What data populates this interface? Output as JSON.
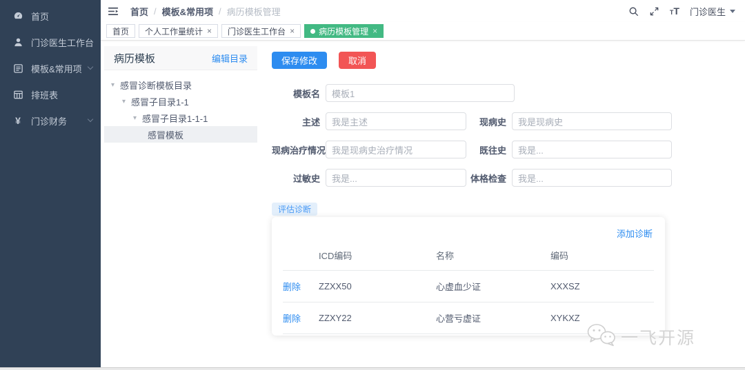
{
  "colors": {
    "sidebar_bg": "#304156",
    "primary_blue": "#2d8cf0",
    "danger_red": "#f25555",
    "tab_green": "#42b983",
    "text_dark": "#515a6e"
  },
  "icons": {
    "close": "×",
    "tree_caret": "▾",
    "yuan": "¥",
    "font_size_small": "T",
    "font_size_large": "T"
  },
  "sidebar": {
    "items": [
      {
        "label": "首页",
        "icon": "dashboard-icon",
        "has_arrow": false
      },
      {
        "label": "门诊医生工作台",
        "icon": "user-icon",
        "has_arrow": false
      },
      {
        "label": "模板&常用项",
        "icon": "template-list-icon",
        "has_arrow": true
      },
      {
        "label": "排班表",
        "icon": "schedule-table-icon",
        "has_arrow": false
      },
      {
        "label": "门诊财务",
        "icon": "yuan-icon",
        "has_arrow": true
      }
    ]
  },
  "header": {
    "breadcrumb": [
      "首页",
      "模板&常用项",
      "病历模板管理"
    ],
    "separator": "/",
    "user": "门诊医生"
  },
  "tabs": [
    {
      "label": "首页",
      "closable": false,
      "active": false
    },
    {
      "label": "个人工作量统计",
      "closable": true,
      "active": false
    },
    {
      "label": "门诊医生工作台",
      "closable": true,
      "active": false
    },
    {
      "label": "病历模板管理",
      "closable": true,
      "active": true
    }
  ],
  "tree_panel": {
    "title": "病历模板",
    "edit_link": "编辑目录",
    "nodes": [
      {
        "label": "感冒诊断模板目录",
        "level": 0,
        "expanded": true
      },
      {
        "label": "感冒子目录1-1",
        "level": 1,
        "expanded": true
      },
      {
        "label": "感冒子目录1-1-1",
        "level": 2,
        "expanded": true
      },
      {
        "label": "感冒模板",
        "level": 3,
        "selected": true
      }
    ]
  },
  "form": {
    "save_label": "保存修改",
    "cancel_label": "取消",
    "fields": [
      {
        "label": "模板名",
        "value": "模板1"
      },
      {
        "label": "主述",
        "value": "我是主述"
      },
      {
        "label": "现病史",
        "value": "我是现病史"
      },
      {
        "label": "现病治疗情况",
        "value": "我是现病史治疗情况"
      },
      {
        "label": "既往史",
        "value": "我是..."
      },
      {
        "label": "过敏史",
        "value": "我是..."
      },
      {
        "label": "体格检查",
        "value": "我是..."
      }
    ],
    "diagnosis_tab": "评估诊断"
  },
  "diagnosis_table": {
    "add_link": "添加诊断",
    "delete_label": "删除",
    "columns": [
      "",
      "ICD编码",
      "名称",
      "编码"
    ],
    "rows": [
      {
        "icd": "ZZXX50",
        "name": "心虚血少证",
        "code": "XXXSZ"
      },
      {
        "icd": "ZZXY22",
        "name": "心营亏虚证",
        "code": "XYKXZ"
      }
    ]
  },
  "watermark": {
    "text": "一飞开源"
  }
}
